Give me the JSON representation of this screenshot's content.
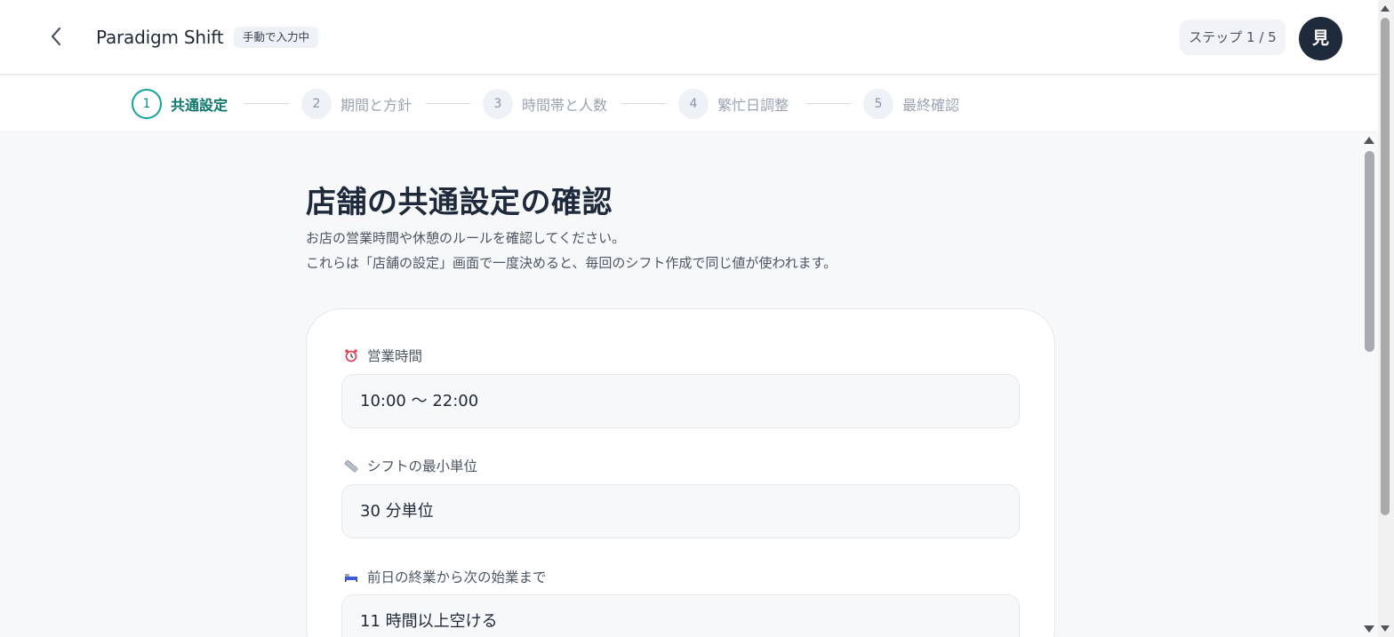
{
  "header": {
    "app_title": "Paradigm Shift",
    "mode_badge": "手動で入力中",
    "step_indicator": "ステップ 1 / 5",
    "avatar_initial": "見"
  },
  "stepper": {
    "steps": [
      {
        "num": "1",
        "label": "共通設定",
        "state": "active"
      },
      {
        "num": "2",
        "label": "期間と方針",
        "state": "inactive"
      },
      {
        "num": "3",
        "label": "時間帯と人数",
        "state": "inactive"
      },
      {
        "num": "4",
        "label": "繁忙日調整",
        "state": "inactive"
      },
      {
        "num": "5",
        "label": "最終確認",
        "state": "inactive"
      }
    ]
  },
  "main": {
    "title": "店舗の共通設定の確認",
    "description_1": "お店の営業時間や休憩のルールを確認してください。",
    "description_2": "これらは「店舗の設定」画面で一度決めると、毎回のシフト作成で同じ値が使われます。",
    "fields": [
      {
        "icon": "alarm-clock-icon",
        "label": "営業時間",
        "value": "10:00 〜 22:00"
      },
      {
        "icon": "ruler-icon",
        "label": "シフトの最小単位",
        "value": "30 分単位"
      },
      {
        "icon": "bed-icon",
        "label": "前日の終業から次の始業まで",
        "value": "11 時間以上空ける"
      }
    ]
  },
  "colors": {
    "accent": "#14a39a",
    "avatar_bg": "#1f2a3c",
    "page_bg": "#f7f8fa"
  }
}
